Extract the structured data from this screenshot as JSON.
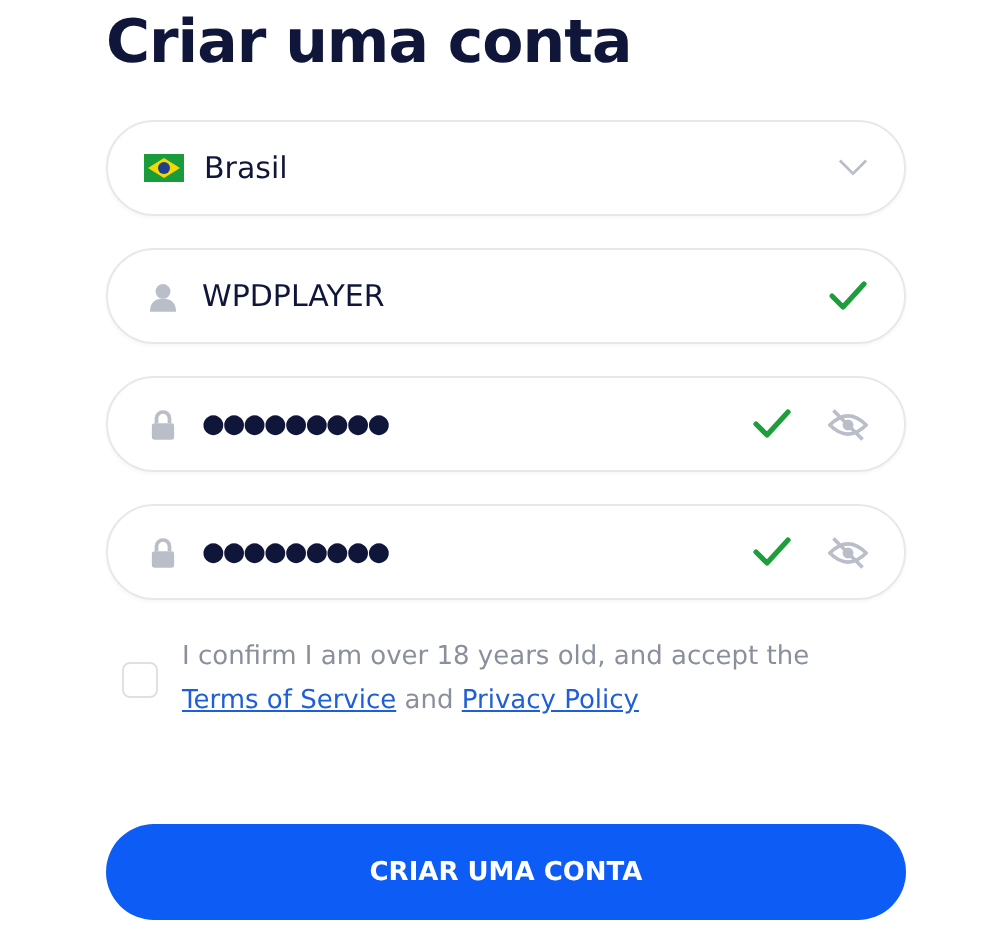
{
  "title": "Criar uma conta",
  "fields": [
    {
      "kind": "select",
      "value": "Brasil",
      "valid": false
    },
    {
      "kind": "text",
      "value": "WPDPLAYER",
      "valid": true
    },
    {
      "kind": "password",
      "value": "●●●●●●●●●",
      "valid": true
    },
    {
      "kind": "password",
      "value": "●●●●●●●●●",
      "valid": true
    }
  ],
  "consent": {
    "checked": false,
    "text": "I confirm I am over 18 years old, and accept the",
    "terms_link": "Terms of Service",
    "joiner": "and",
    "privacy_link": "Privacy Policy"
  },
  "submit": "CRIAR UMA CONTA"
}
